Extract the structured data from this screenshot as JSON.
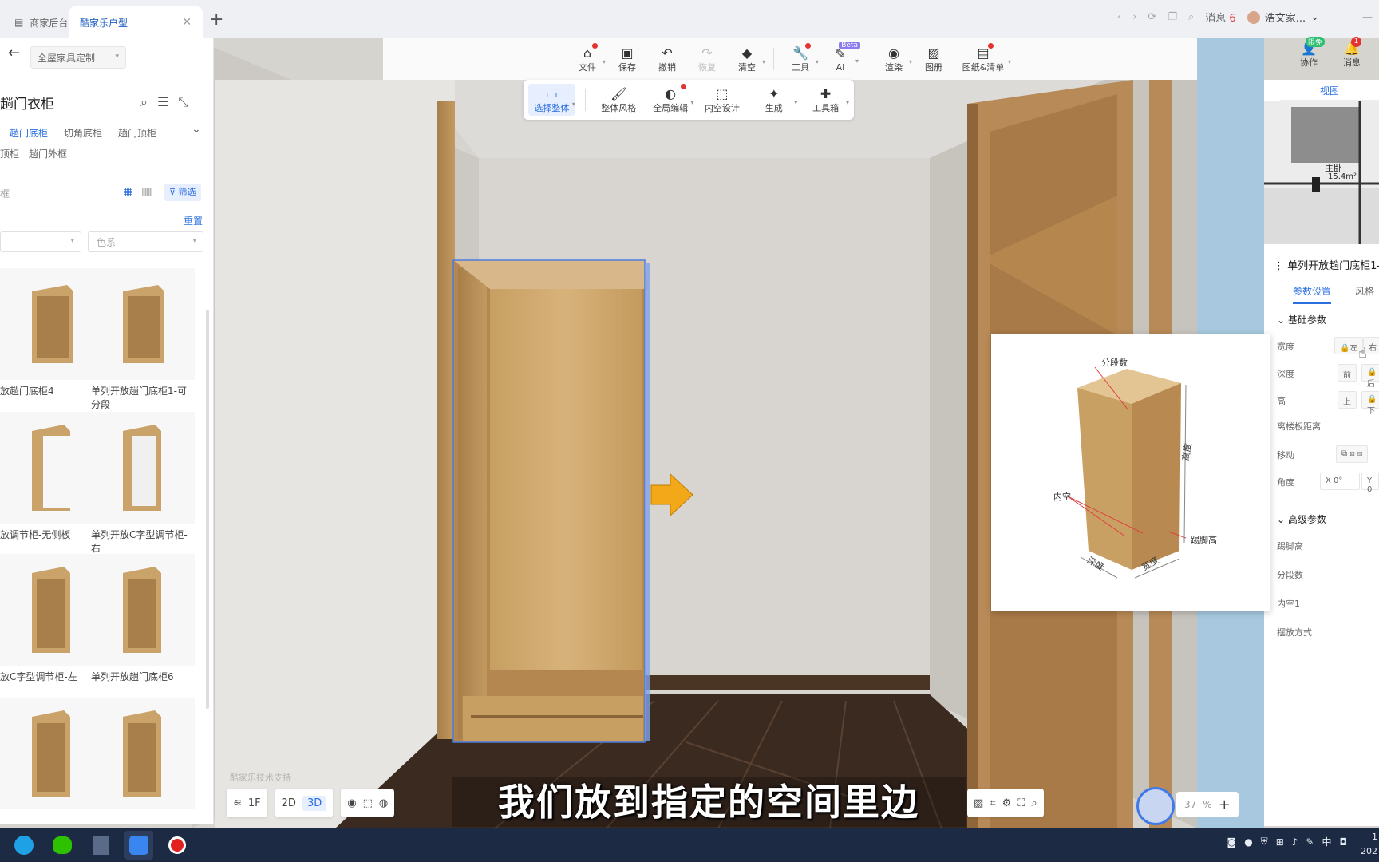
{
  "browser": {
    "tabs": [
      {
        "label": "商家后台",
        "active": false
      },
      {
        "label": "酷家乐户型",
        "active": true
      }
    ],
    "messages_label": "消息",
    "messages_count": "6",
    "user_name": "浩文家..."
  },
  "toolbar": {
    "items": [
      {
        "label": "文件",
        "icon": "home-icon"
      },
      {
        "label": "保存",
        "icon": "save-icon"
      },
      {
        "label": "撤销",
        "icon": "undo-icon"
      },
      {
        "label": "恢复",
        "icon": "redo-icon"
      },
      {
        "label": "清空",
        "icon": "eraser-icon"
      },
      {
        "label": "工具",
        "icon": "wrench-icon"
      },
      {
        "label": "AI",
        "icon": "ai-icon",
        "badge": "Beta"
      },
      {
        "label": "渲染",
        "icon": "camera-icon"
      },
      {
        "label": "图册",
        "icon": "image-icon"
      },
      {
        "label": "图纸&清单",
        "icon": "document-icon"
      }
    ],
    "collab_label": "协作",
    "collab_badge": "限免",
    "notify_label": "消息",
    "notify_count": "1"
  },
  "subtoolbar": {
    "items": [
      {
        "label": "选择整体",
        "selected": true
      },
      {
        "label": "整体风格"
      },
      {
        "label": "全局编辑"
      },
      {
        "label": "内空设计"
      },
      {
        "label": "生成"
      },
      {
        "label": "工具箱"
      }
    ]
  },
  "left_panel": {
    "scope": "全屋家具定制",
    "title": "趟门衣柜",
    "subtabs": [
      "趟门底柜",
      "切角底柜",
      "趟门顶柜",
      "顶柜",
      "趟门外框"
    ],
    "search_fragment": "框",
    "filter_label": "筛选",
    "reset_label": "重置",
    "color_placeholder": "色系",
    "products": [
      "放趟门底柜4",
      "单列开放趟门底柜1-可分段",
      "放调节柜-无侧板",
      "单列开放C字型调节柜-右",
      "放C字型调节柜-左",
      "单列开放趟门底柜6",
      "",
      ""
    ]
  },
  "right_panel": {
    "view_tab": "视图",
    "room_name": "主卧",
    "room_area": "15.4m²",
    "title": "单列开放趟门底柜1-",
    "tabs": [
      "参数设置",
      "风格"
    ],
    "basic_section": "基础参数",
    "basic_params": [
      {
        "label": "宽度",
        "buttons": [
          "左",
          "右"
        ]
      },
      {
        "label": "深度",
        "buttons": [
          "前",
          "后"
        ]
      },
      {
        "label": "高",
        "buttons": [
          "上",
          "下"
        ]
      },
      {
        "label": "离楼板距离",
        "buttons": []
      },
      {
        "label": "移动",
        "buttons": []
      },
      {
        "label": "角度",
        "buttons": [
          "X 0°",
          "Y 0"
        ]
      }
    ],
    "advanced_section": "高级参数",
    "advanced_params": [
      "踢脚高",
      "分段数",
      "内空1",
      "摆放方式"
    ]
  },
  "diagram": {
    "labels": {
      "segments": "分段数",
      "height": "高度",
      "inner": "内空",
      "kick": "踢脚高",
      "depth": "深度",
      "width": "宽度"
    }
  },
  "bottom": {
    "floor": "1F",
    "mode_2d": "2D",
    "mode_3d": "3D",
    "zoom_value": "37",
    "zoom_unit": "%",
    "watermark": "酷家乐技术支持"
  },
  "subtitle": "我们放到指定的空间里边",
  "taskbar": {
    "input_method": "中",
    "clock_time": "1",
    "clock_date": "202"
  },
  "colors": {
    "accent": "#2b6fe0",
    "wood": "#c9a36a",
    "floor": "#3b2a20",
    "arrow": "#f2a818"
  }
}
